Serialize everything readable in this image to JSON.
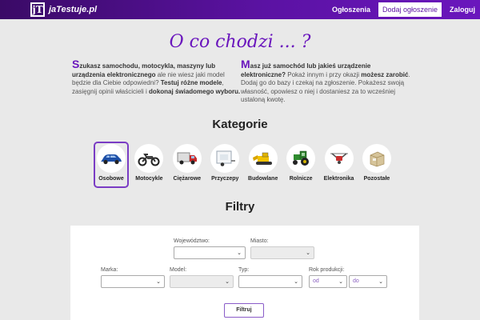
{
  "navbar": {
    "logo_glyph": "jT",
    "brand": "jaTestuje.pl",
    "links": [
      {
        "label": "Ogłoszenia"
      },
      {
        "label": "Dodaj ogłoszenie"
      },
      {
        "label": "Zaloguj"
      }
    ],
    "active_index": 1
  },
  "hero": {
    "title": "O co chodzi ... ?",
    "left": {
      "drop": "S",
      "t1": "zukasz samochodu, motocykla, maszyny lub urządzenia elektronicznego",
      "t2": " ale nie wiesz jaki model będzie dla Ciebie odpowiedni? ",
      "b1": "Testuj różne modele",
      "t3": ", zasięgnij opinii właścicieli i ",
      "b2": "dokonaj świadomego wyboru."
    },
    "right": {
      "drop": "M",
      "t1": "asz już samochód lub jakieś urządzenie elektroniczne?",
      "t2": " Pokaż innym i przy okazji ",
      "b1": "możesz zarobić",
      "t3": ". Dodaj go do bazy i czekaj na zgłoszenie. Pokażesz swoją własność, opowiesz o niej i dostaniesz za to wcześniej ustaloną kwotę."
    }
  },
  "categories": {
    "title": "Kategorie",
    "selected_index": 0,
    "items": [
      {
        "label": "Osobowe",
        "icon": "car-icon"
      },
      {
        "label": "Motocykle",
        "icon": "motorcycle-icon"
      },
      {
        "label": "Ciężarowe",
        "icon": "truck-icon"
      },
      {
        "label": "Przyczepy",
        "icon": "trailer-icon"
      },
      {
        "label": "Budowlane",
        "icon": "construction-machine-icon"
      },
      {
        "label": "Rolnicze",
        "icon": "tractor-icon"
      },
      {
        "label": "Elektronika",
        "icon": "drone-icon"
      },
      {
        "label": "Pozostałe",
        "icon": "package-icon"
      }
    ]
  },
  "filters": {
    "title": "Filtry",
    "wojewodztwo_label": "Województwo:",
    "miasto_label": "Miasto:",
    "marka_label": "Marka:",
    "model_label": "Model:",
    "typ_label": "Typ:",
    "rok_label": "Rok produkcji:",
    "rok_od": "od",
    "rok_do": "do",
    "submit": "Filtruj"
  },
  "colors": {
    "accent": "#6a16bd",
    "nav_start": "#3a0a66",
    "nav_end": "#6a16bd"
  }
}
